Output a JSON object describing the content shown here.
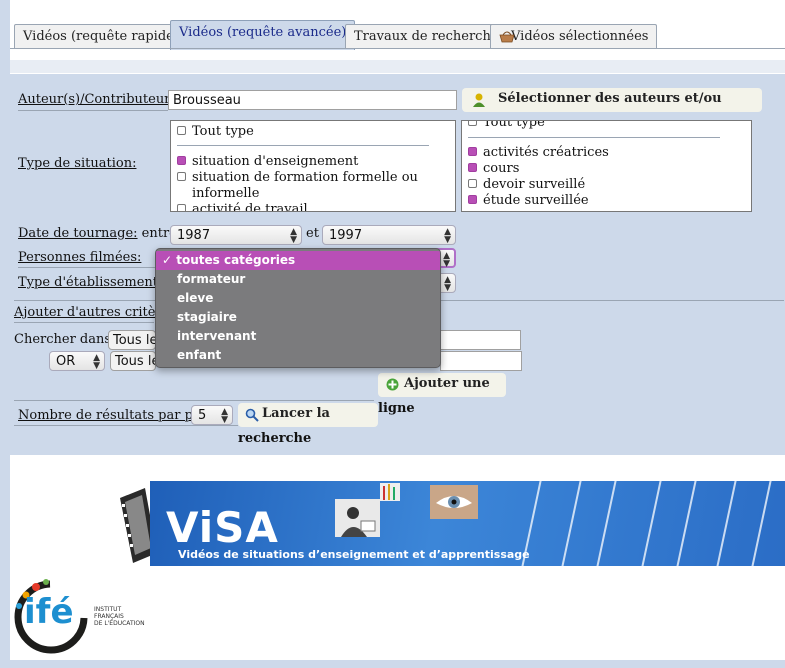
{
  "tabs": [
    {
      "label": "Vidéos (requête rapide)",
      "active": false
    },
    {
      "label": "Vidéos (requête avancée)",
      "active": true
    },
    {
      "label": "Travaux de recherche",
      "active": false
    },
    {
      "label": "Vidéos sélectionnées",
      "active": false
    }
  ],
  "form": {
    "authors_label": "Auteur(s)/Contributeur(s):",
    "authors_value": "Brousseau",
    "select_authors_button": "Sélectionner des auteurs et/ou",
    "situation_label": "Type de situation:",
    "situation_list_left": [
      {
        "label": "Tout type",
        "checked": false
      },
      {
        "label": "situation d'enseignement",
        "checked": true
      },
      {
        "label": "situation de formation formelle ou",
        "checked": false
      },
      {
        "label": "informelle",
        "checked": null
      },
      {
        "label": "activité de travail",
        "checked": false
      }
    ],
    "situation_list_right": [
      {
        "label": "Tout type",
        "checked": false
      },
      {
        "label": "activités créatrices",
        "checked": true
      },
      {
        "label": "cours",
        "checked": true
      },
      {
        "label": "devoir surveillé",
        "checked": false
      },
      {
        "label": "étude surveillée",
        "checked": true
      }
    ],
    "date_label": "Date de tournage:",
    "date_between": "entre",
    "date_from": "1987",
    "date_and": "et",
    "date_to": "1997",
    "persons_label": "Personnes filmées:",
    "establishment_label": "Type d'établissement:",
    "add_criteria_label": "Ajouter d'autres critères :",
    "search_in_label": "Chercher dans :",
    "search_field_1": "Tous le",
    "search_field_2": "Tous le",
    "operator": "OR",
    "add_line_button_1": "Ajouter une",
    "add_line_button_2": "ligne",
    "results_label": "Nombre de résultats par page:",
    "results_value": "5",
    "launch_button_1": "Lancer la",
    "launch_button_2": "recherche"
  },
  "persons_dropdown": {
    "options": [
      "toutes catégories",
      "formateur",
      "eleve",
      "stagiaire",
      "intervenant",
      "enfant"
    ],
    "selected": "toutes catégories",
    "check_glyph": "✓"
  },
  "banner": {
    "title": "ViSA",
    "subtitle": "Vidéos de situations d’enseignement et d’apprentissage"
  },
  "logo": {
    "name": "ifé",
    "line1": "INSTITUT",
    "line2": "FRANÇAIS",
    "line3": "DE L'ÉDUCATION"
  },
  "colors": {
    "panel_bg": "#cdd9ea",
    "accent_purple": "#b84fb6",
    "active_tab_text": "#1a2a8a"
  }
}
